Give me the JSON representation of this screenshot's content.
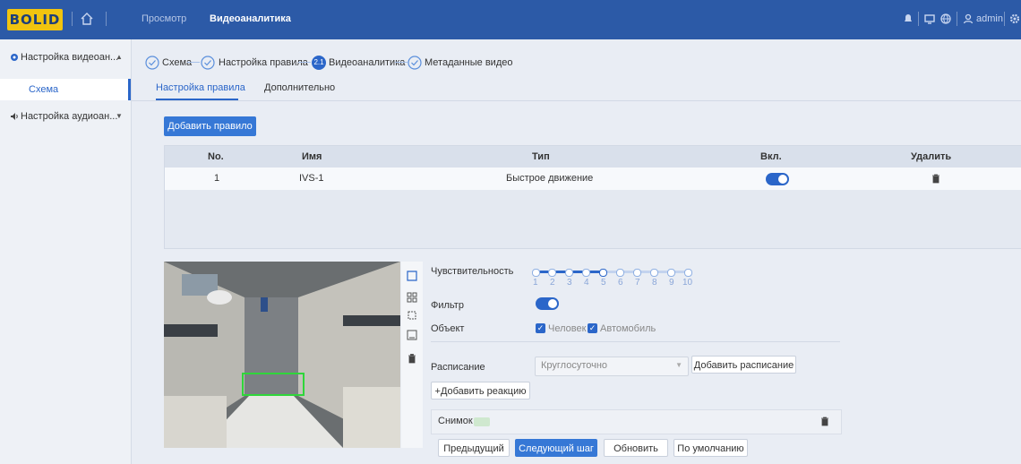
{
  "header": {
    "logo_text": "BOLID",
    "nav": [
      "Просмотр",
      "Видеоаналитика"
    ],
    "user": "admin"
  },
  "sidebar": {
    "items": [
      {
        "label": "Настройка видеоан...",
        "expanded": true
      },
      {
        "label": "Схема",
        "active": true
      },
      {
        "label": "Настройка аудиоан...",
        "expanded": false
      }
    ]
  },
  "steps": [
    {
      "label": "Схема",
      "state": "done"
    },
    {
      "label": "Настройка правила",
      "state": "done"
    },
    {
      "number": "2.1",
      "label": "Видеоаналитика",
      "state": "current"
    },
    {
      "label": "Метаданные видео",
      "state": "done"
    }
  ],
  "tabs": [
    "Настройка правила",
    "Дополнительно"
  ],
  "add_rule_label": "Добавить правило",
  "table": {
    "headers": [
      "No.",
      "Имя",
      "Тип",
      "Вкл.",
      "Удалить"
    ],
    "rows": [
      {
        "no": "1",
        "name": "IVS-1",
        "type": "Быстрое движение",
        "enabled": true
      }
    ]
  },
  "settings": {
    "sensitivity_label": "Чувствительность",
    "sensitivity_value": 5,
    "sensitivity_ticks": [
      "1",
      "2",
      "3",
      "4",
      "5",
      "6",
      "7",
      "8",
      "9",
      "10"
    ],
    "filter_label": "Фильтр",
    "filter_on": true,
    "object_label": "Объект",
    "objects": [
      {
        "label": "Человек",
        "checked": true
      },
      {
        "label": "Автомобиль",
        "checked": true
      }
    ],
    "schedule_label": "Расписание",
    "schedule_value": "Круглосуточно",
    "add_schedule": "Добавить расписание",
    "add_reaction": "+Добавить реакцию",
    "snapshot_label": "Снимок"
  },
  "footer_buttons": {
    "prev": "Предыдущий",
    "next": "Следующий шаг",
    "refresh": "Обновить",
    "default": "По умолчанию"
  },
  "colors": {
    "header": "#2c5aa7",
    "accent": "#2b66c9",
    "logo": "#f1c40f"
  }
}
